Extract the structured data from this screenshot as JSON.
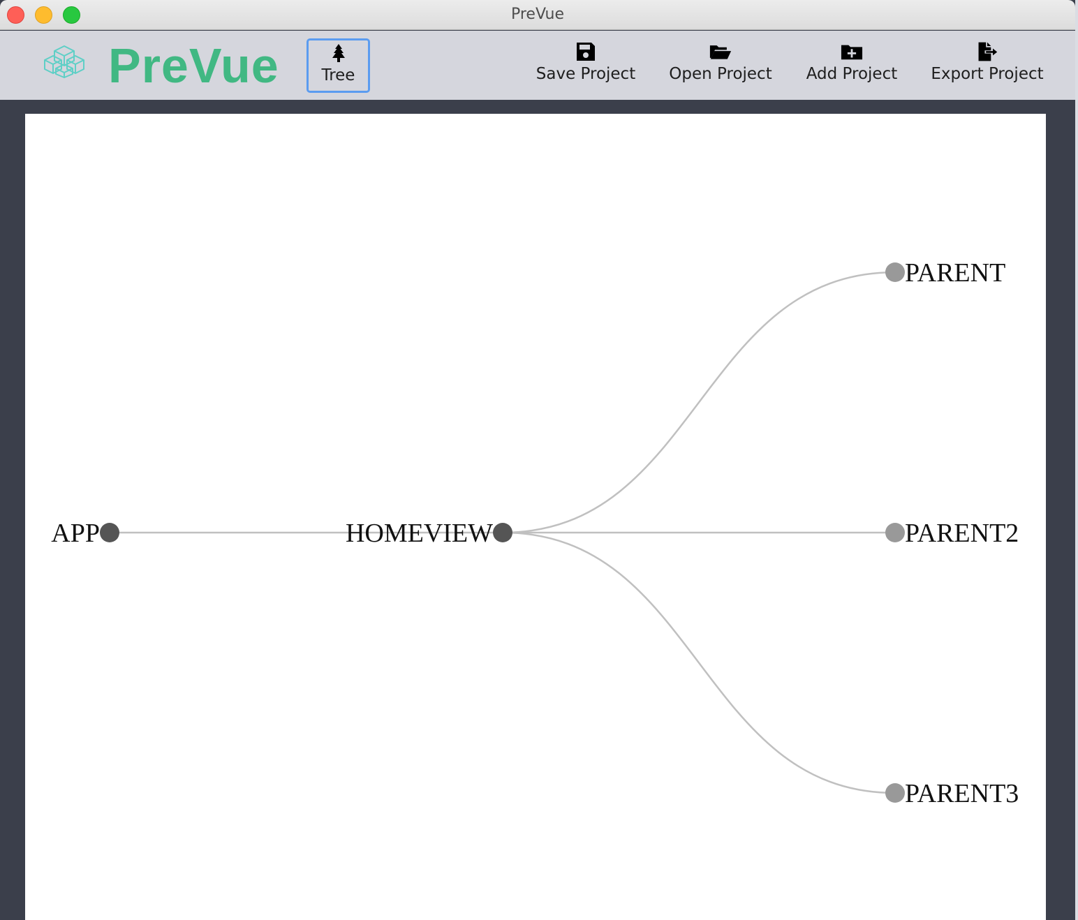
{
  "window": {
    "title": "PreVue"
  },
  "toolbar": {
    "brand": "PreVue",
    "tree_label": "Tree",
    "buttons": [
      {
        "label": "Save Project",
        "icon": "save-icon"
      },
      {
        "label": "Open Project",
        "icon": "folder-open-icon"
      },
      {
        "label": "Add Project",
        "icon": "folder-plus-icon"
      },
      {
        "label": "Export Project",
        "icon": "file-export-icon"
      }
    ]
  },
  "tree": {
    "name": "APP",
    "children": [
      {
        "name": "HOMEVIEW",
        "children": [
          {
            "name": "PARENT"
          },
          {
            "name": "PARENT2"
          },
          {
            "name": "PARENT3"
          }
        ]
      }
    ]
  },
  "colors": {
    "brand": "#41b883",
    "node_parent": "#555555",
    "node_leaf": "#999999",
    "link": "#c0c0c0",
    "selected_border": "#5b9cf0",
    "background": "#3b3f4b"
  }
}
